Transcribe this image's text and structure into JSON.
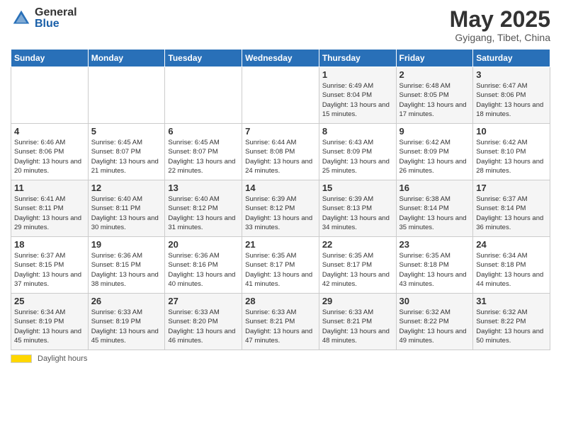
{
  "header": {
    "logo_general": "General",
    "logo_blue": "Blue",
    "month_year": "May 2025",
    "location": "Gyigang, Tibet, China"
  },
  "footer": {
    "legend_label": "Daylight hours"
  },
  "days_of_week": [
    "Sunday",
    "Monday",
    "Tuesday",
    "Wednesday",
    "Thursday",
    "Friday",
    "Saturday"
  ],
  "weeks": [
    [
      {
        "day": "",
        "info": ""
      },
      {
        "day": "",
        "info": ""
      },
      {
        "day": "",
        "info": ""
      },
      {
        "day": "",
        "info": ""
      },
      {
        "day": "1",
        "info": "Sunrise: 6:49 AM\nSunset: 8:04 PM\nDaylight: 13 hours\nand 15 minutes."
      },
      {
        "day": "2",
        "info": "Sunrise: 6:48 AM\nSunset: 8:05 PM\nDaylight: 13 hours\nand 17 minutes."
      },
      {
        "day": "3",
        "info": "Sunrise: 6:47 AM\nSunset: 8:06 PM\nDaylight: 13 hours\nand 18 minutes."
      }
    ],
    [
      {
        "day": "4",
        "info": "Sunrise: 6:46 AM\nSunset: 8:06 PM\nDaylight: 13 hours\nand 20 minutes."
      },
      {
        "day": "5",
        "info": "Sunrise: 6:45 AM\nSunset: 8:07 PM\nDaylight: 13 hours\nand 21 minutes."
      },
      {
        "day": "6",
        "info": "Sunrise: 6:45 AM\nSunset: 8:07 PM\nDaylight: 13 hours\nand 22 minutes."
      },
      {
        "day": "7",
        "info": "Sunrise: 6:44 AM\nSunset: 8:08 PM\nDaylight: 13 hours\nand 24 minutes."
      },
      {
        "day": "8",
        "info": "Sunrise: 6:43 AM\nSunset: 8:09 PM\nDaylight: 13 hours\nand 25 minutes."
      },
      {
        "day": "9",
        "info": "Sunrise: 6:42 AM\nSunset: 8:09 PM\nDaylight: 13 hours\nand 26 minutes."
      },
      {
        "day": "10",
        "info": "Sunrise: 6:42 AM\nSunset: 8:10 PM\nDaylight: 13 hours\nand 28 minutes."
      }
    ],
    [
      {
        "day": "11",
        "info": "Sunrise: 6:41 AM\nSunset: 8:11 PM\nDaylight: 13 hours\nand 29 minutes."
      },
      {
        "day": "12",
        "info": "Sunrise: 6:40 AM\nSunset: 8:11 PM\nDaylight: 13 hours\nand 30 minutes."
      },
      {
        "day": "13",
        "info": "Sunrise: 6:40 AM\nSunset: 8:12 PM\nDaylight: 13 hours\nand 31 minutes."
      },
      {
        "day": "14",
        "info": "Sunrise: 6:39 AM\nSunset: 8:12 PM\nDaylight: 13 hours\nand 33 minutes."
      },
      {
        "day": "15",
        "info": "Sunrise: 6:39 AM\nSunset: 8:13 PM\nDaylight: 13 hours\nand 34 minutes."
      },
      {
        "day": "16",
        "info": "Sunrise: 6:38 AM\nSunset: 8:14 PM\nDaylight: 13 hours\nand 35 minutes."
      },
      {
        "day": "17",
        "info": "Sunrise: 6:37 AM\nSunset: 8:14 PM\nDaylight: 13 hours\nand 36 minutes."
      }
    ],
    [
      {
        "day": "18",
        "info": "Sunrise: 6:37 AM\nSunset: 8:15 PM\nDaylight: 13 hours\nand 37 minutes."
      },
      {
        "day": "19",
        "info": "Sunrise: 6:36 AM\nSunset: 8:15 PM\nDaylight: 13 hours\nand 38 minutes."
      },
      {
        "day": "20",
        "info": "Sunrise: 6:36 AM\nSunset: 8:16 PM\nDaylight: 13 hours\nand 40 minutes."
      },
      {
        "day": "21",
        "info": "Sunrise: 6:35 AM\nSunset: 8:17 PM\nDaylight: 13 hours\nand 41 minutes."
      },
      {
        "day": "22",
        "info": "Sunrise: 6:35 AM\nSunset: 8:17 PM\nDaylight: 13 hours\nand 42 minutes."
      },
      {
        "day": "23",
        "info": "Sunrise: 6:35 AM\nSunset: 8:18 PM\nDaylight: 13 hours\nand 43 minutes."
      },
      {
        "day": "24",
        "info": "Sunrise: 6:34 AM\nSunset: 8:18 PM\nDaylight: 13 hours\nand 44 minutes."
      }
    ],
    [
      {
        "day": "25",
        "info": "Sunrise: 6:34 AM\nSunset: 8:19 PM\nDaylight: 13 hours\nand 45 minutes."
      },
      {
        "day": "26",
        "info": "Sunrise: 6:33 AM\nSunset: 8:19 PM\nDaylight: 13 hours\nand 45 minutes."
      },
      {
        "day": "27",
        "info": "Sunrise: 6:33 AM\nSunset: 8:20 PM\nDaylight: 13 hours\nand 46 minutes."
      },
      {
        "day": "28",
        "info": "Sunrise: 6:33 AM\nSunset: 8:21 PM\nDaylight: 13 hours\nand 47 minutes."
      },
      {
        "day": "29",
        "info": "Sunrise: 6:33 AM\nSunset: 8:21 PM\nDaylight: 13 hours\nand 48 minutes."
      },
      {
        "day": "30",
        "info": "Sunrise: 6:32 AM\nSunset: 8:22 PM\nDaylight: 13 hours\nand 49 minutes."
      },
      {
        "day": "31",
        "info": "Sunrise: 6:32 AM\nSunset: 8:22 PM\nDaylight: 13 hours\nand 50 minutes."
      }
    ]
  ]
}
